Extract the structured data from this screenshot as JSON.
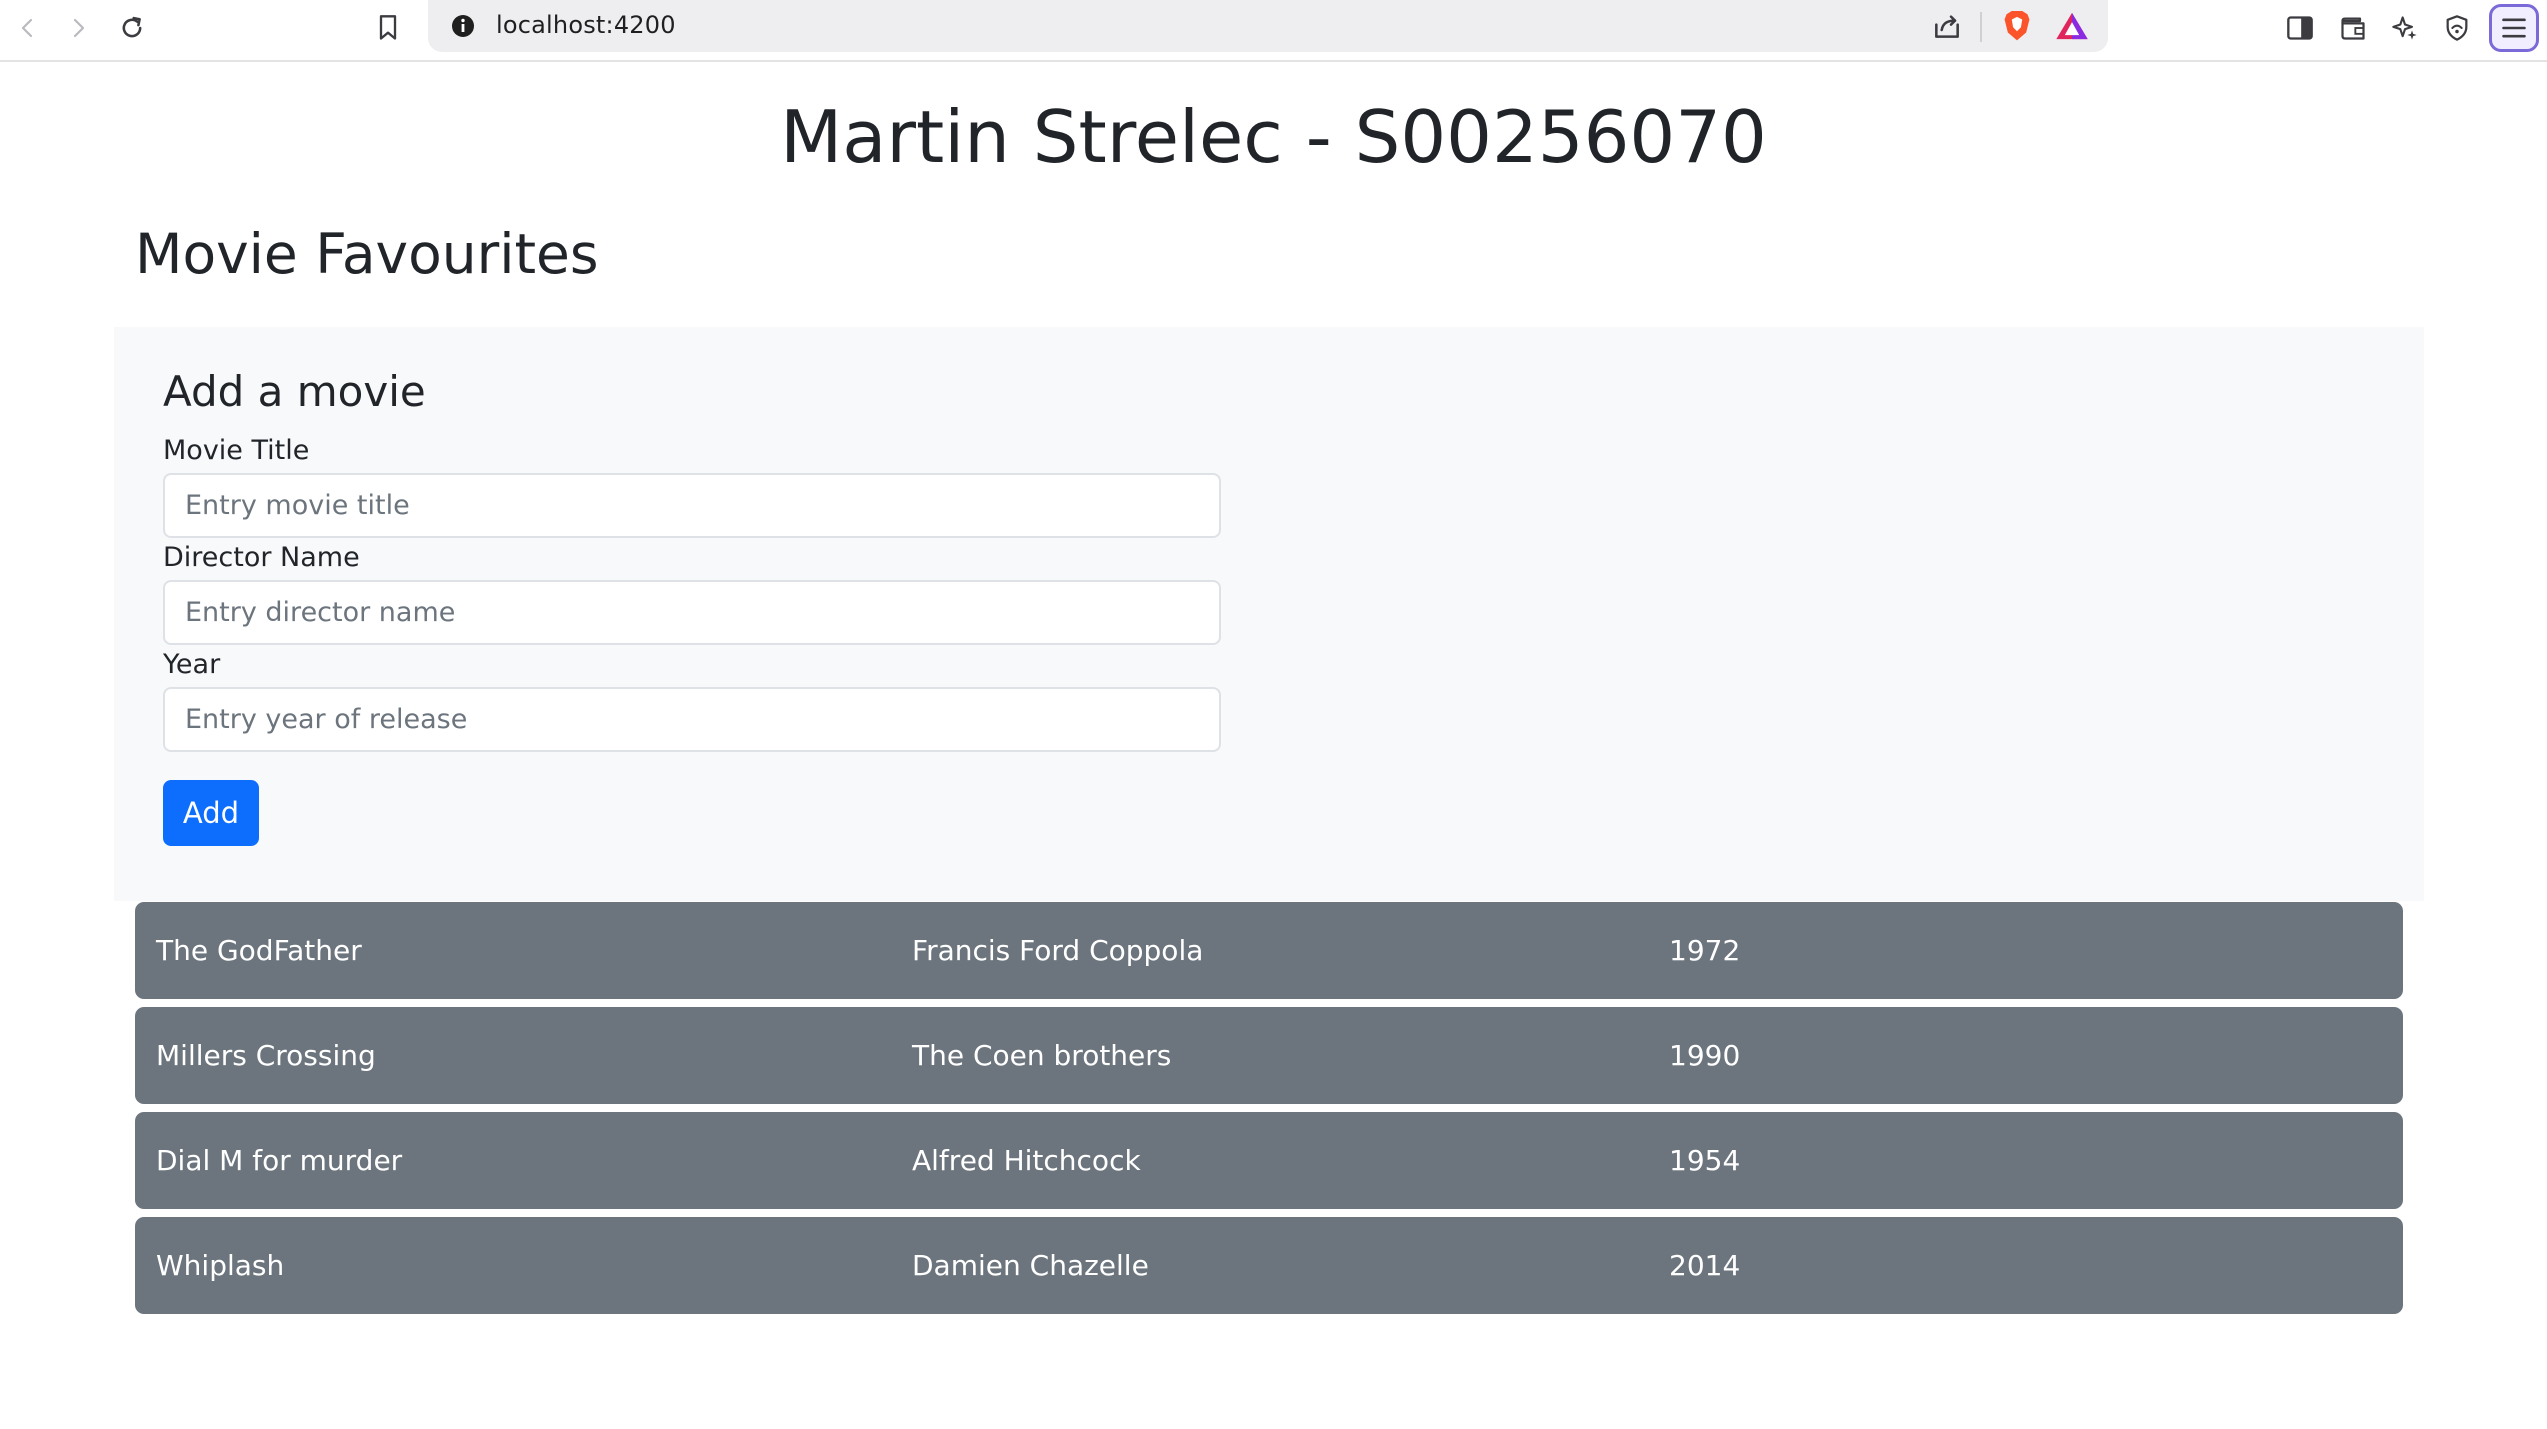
{
  "browser": {
    "url": "localhost:4200"
  },
  "page": {
    "heading": "Martin Strelec - S00256070",
    "section_title": "Movie Favourites"
  },
  "form": {
    "title": "Add a movie",
    "fields": [
      {
        "label": "Movie Title",
        "placeholder": "Entry movie title",
        "value": ""
      },
      {
        "label": "Director Name",
        "placeholder": "Entry director name",
        "value": ""
      },
      {
        "label": "Year",
        "placeholder": "Entry year of release",
        "value": ""
      }
    ],
    "submit_label": "Add"
  },
  "movies": [
    {
      "title": "The GodFather",
      "director": "Francis Ford Coppola",
      "year": "1972"
    },
    {
      "title": "Millers Crossing",
      "director": "The Coen brothers",
      "year": "1990"
    },
    {
      "title": "Dial M for murder",
      "director": "Alfred Hitchcock",
      "year": "1954"
    },
    {
      "title": "Whiplash",
      "director": "Damien Chazelle",
      "year": "2014"
    }
  ],
  "colors": {
    "primary": "#0d6efd",
    "row_background": "#6c757d",
    "panel_background": "#f8f9fa",
    "brave_orange": "#fb542b"
  },
  "icons": [
    "back-icon",
    "forward-icon",
    "reload-icon",
    "bookmark-icon",
    "site-info-icon",
    "share-icon",
    "brave-shields-icon",
    "brave-rewards-icon",
    "sidebar-icon",
    "wallet-icon",
    "leo-ai-icon",
    "vpn-icon",
    "menu-icon"
  ]
}
